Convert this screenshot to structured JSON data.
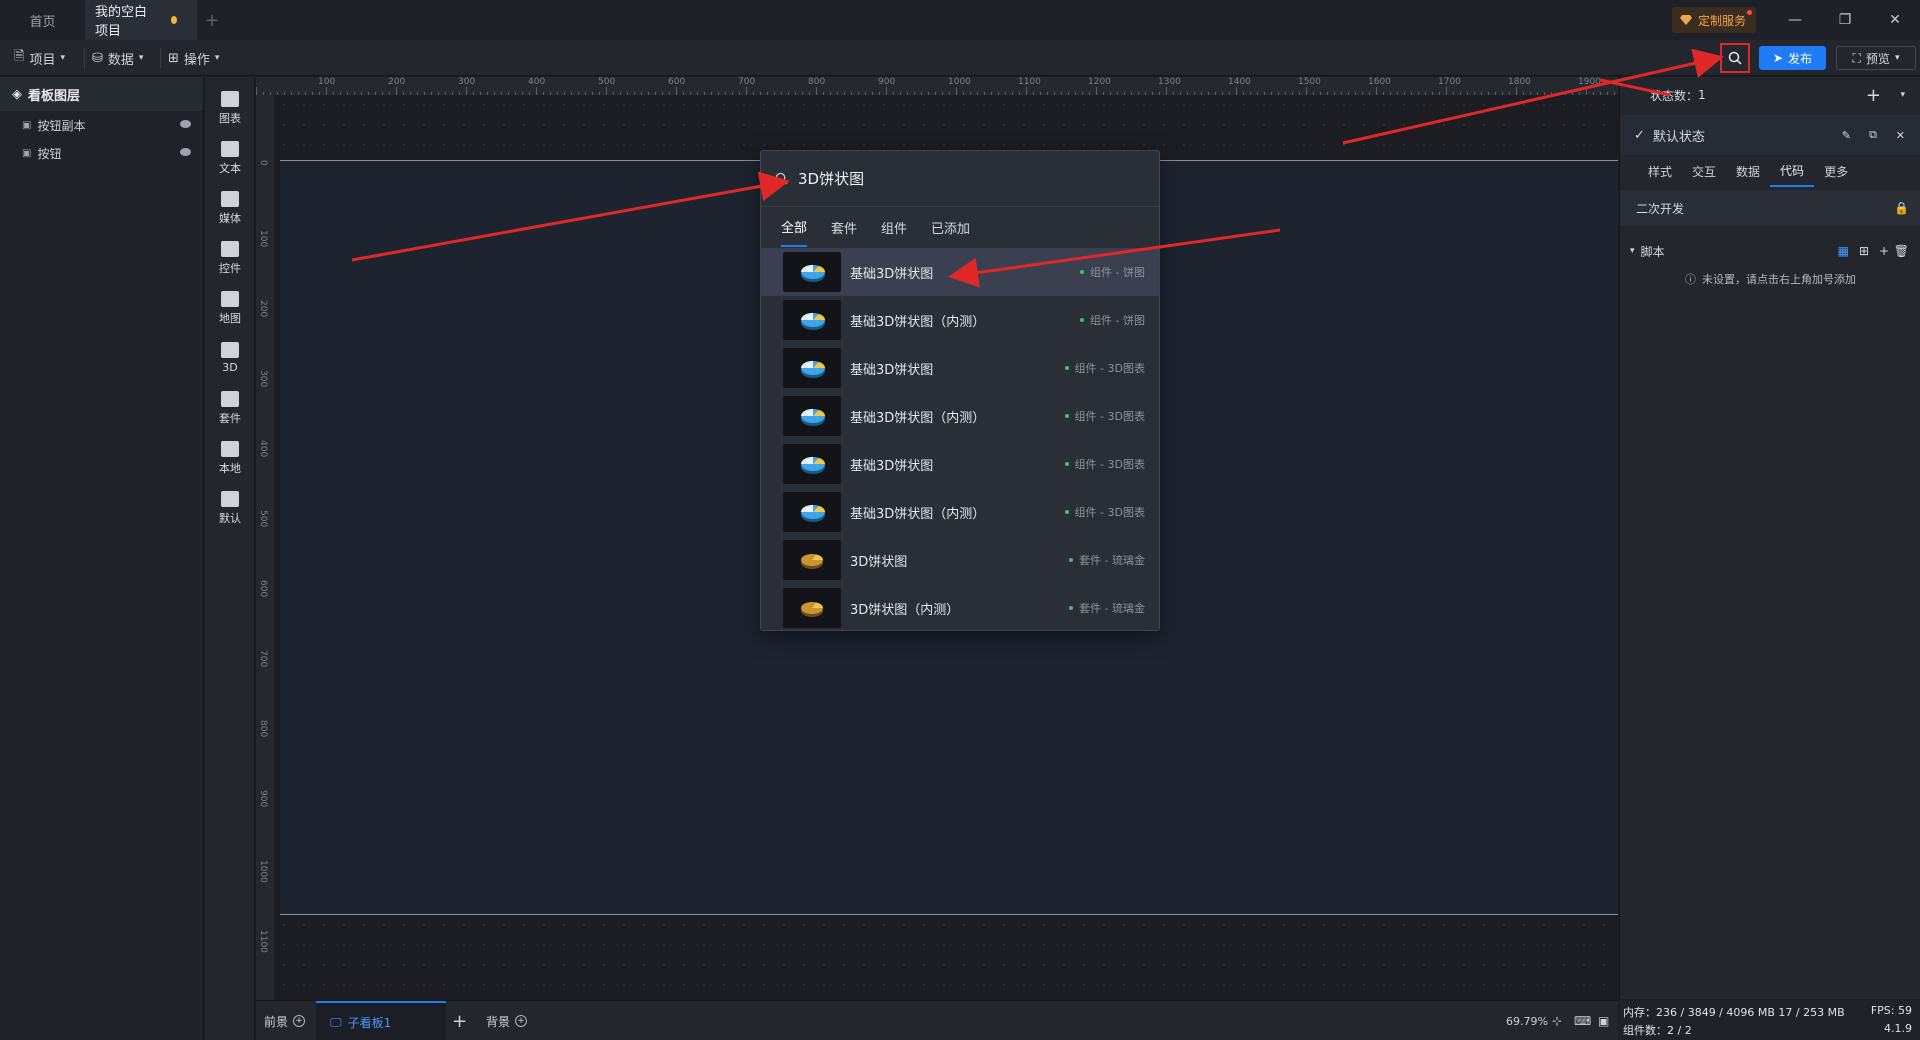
{
  "titlebar": {
    "tabs": [
      {
        "label": "首页"
      },
      {
        "label": "我的空白项目"
      }
    ],
    "custom_service": "定制服务"
  },
  "toolbar": {
    "menus": [
      {
        "label": "项目",
        "icon": "file-icon"
      },
      {
        "label": "数据",
        "icon": "database-icon"
      },
      {
        "label": "操作",
        "icon": "grid-icon"
      }
    ],
    "publish_label": "发布",
    "preview_label": "预览"
  },
  "layers": {
    "title": "看板图层",
    "items": [
      {
        "label": "按钮副本"
      },
      {
        "label": "按钮"
      }
    ]
  },
  "components": [
    {
      "label": "图表",
      "icon": "bar-chart-icon"
    },
    {
      "label": "文本",
      "icon": "text-icon"
    },
    {
      "label": "媒体",
      "icon": "media-icon"
    },
    {
      "label": "控件",
      "icon": "control-icon"
    },
    {
      "label": "地图",
      "icon": "map-icon"
    },
    {
      "label": "3D",
      "icon": "cube-icon"
    },
    {
      "label": "套件",
      "icon": "kit-icon"
    },
    {
      "label": "本地",
      "icon": "puzzle-icon"
    },
    {
      "label": "默认",
      "icon": "bar-chart-icon"
    }
  ],
  "ruler": {
    "top": [
      "100",
      "200",
      "300",
      "400",
      "500",
      "600",
      "700",
      "800",
      "900",
      "1000",
      "1100",
      "1200",
      "1300",
      "1400",
      "1500",
      "1600",
      "1700",
      "1800",
      "1900"
    ],
    "left": [
      "0",
      "100",
      "200",
      "300",
      "400",
      "500",
      "600",
      "700",
      "800",
      "900",
      "1000",
      "1100"
    ]
  },
  "search_popup": {
    "query": "3D饼状图",
    "tabs": [
      {
        "label": "全部",
        "active": true
      },
      {
        "label": "套件"
      },
      {
        "label": "组件"
      },
      {
        "label": "已添加"
      }
    ],
    "results": [
      {
        "name": "基础3D饼状图",
        "tag": "组件 - 饼图",
        "thumb": "blue-pie"
      },
      {
        "name": "基础3D饼状图（内测）",
        "tag": "组件 - 饼图",
        "thumb": "blue-pie"
      },
      {
        "name": "基础3D饼状图",
        "tag": "组件 - 3D图表",
        "thumb": "blue-pie"
      },
      {
        "name": "基础3D饼状图（内测）",
        "tag": "组件 - 3D图表",
        "thumb": "blue-pie"
      },
      {
        "name": "基础3D饼状图",
        "tag": "组件 - 3D图表",
        "thumb": "blue-pie"
      },
      {
        "name": "基础3D饼状图（内测）",
        "tag": "组件 - 3D图表",
        "thumb": "blue-pie"
      },
      {
        "name": "3D饼状图",
        "tag": "套件 - 琉璃金",
        "thumb": "gold-pie"
      },
      {
        "name": "3D饼状图（内测）",
        "tag": "套件 - 琉璃金",
        "thumb": "gold-pie"
      }
    ]
  },
  "bottombar": {
    "foreground": "前景",
    "subboard": "子看板1",
    "background": "背景",
    "zoom": "69.79%"
  },
  "right_panel": {
    "state_count_label": "状态数：",
    "state_count": "1",
    "default_state": "默认状态",
    "tabs": [
      "样式",
      "交互",
      "数据",
      "代码",
      "更多"
    ],
    "active_tab": "代码",
    "secondary_dev": "二次开发",
    "script_label": "脚本",
    "script_hint": "未设置，请点击右上角加号添加"
  },
  "status": {
    "memory": "内存：236 / 3849 / 4096 MB  17 / 253 MB",
    "fps": "FPS:  59",
    "component_count": "组件数：2 / 2",
    "version": "4.1.9"
  },
  "colors": {
    "accent": "#1f7cf5",
    "annotation": "#e12828",
    "canvas": "#1d2430",
    "panel": "#23262d"
  }
}
